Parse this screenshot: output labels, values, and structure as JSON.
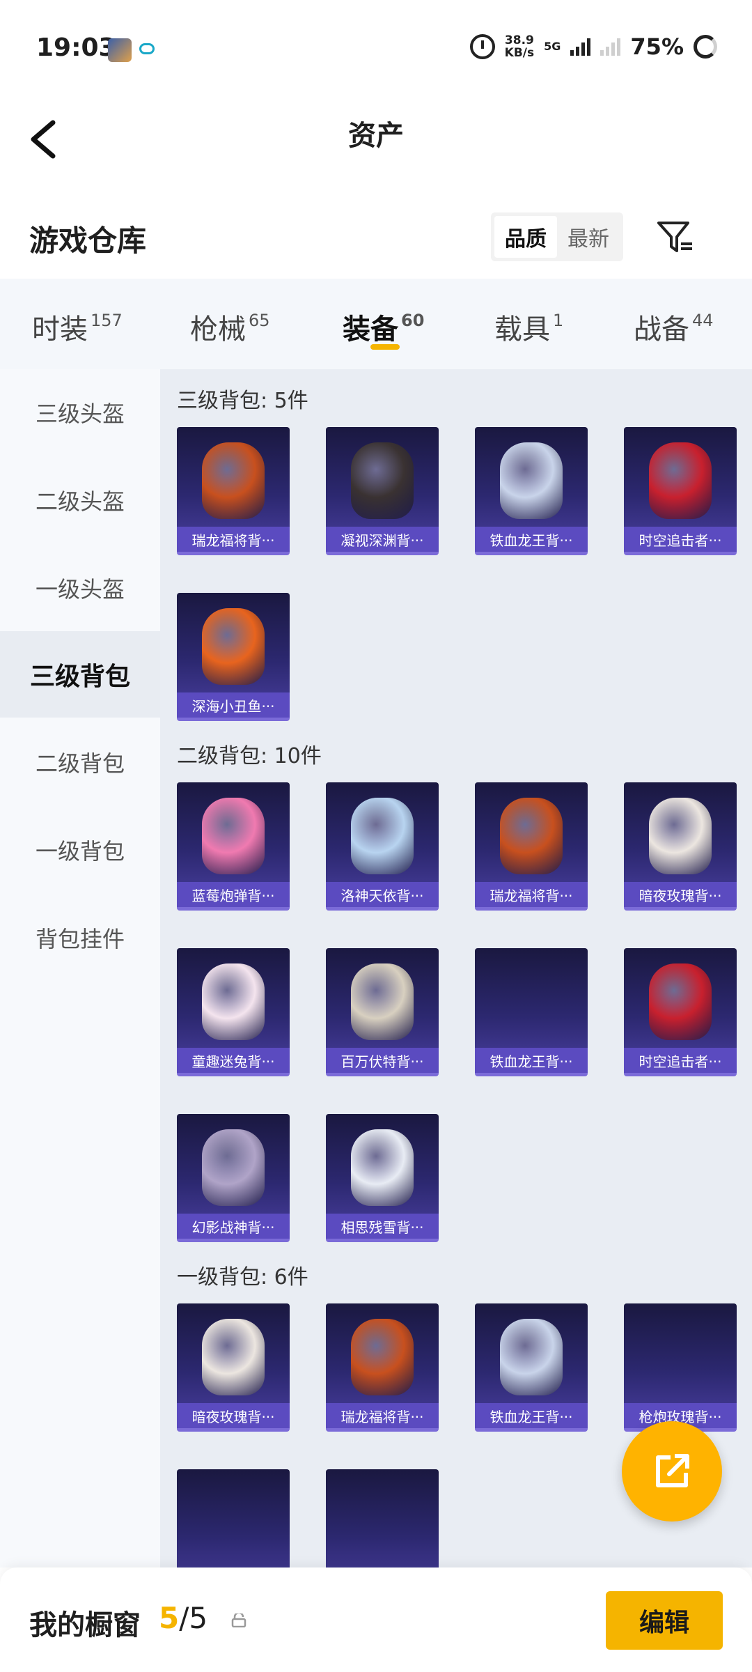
{
  "status_bar": {
    "time": "19:03",
    "net_speed_value": "38.9",
    "net_speed_unit": "KB/s",
    "network_type": "5G",
    "battery": "75%"
  },
  "header": {
    "title": "资产"
  },
  "warehouse": {
    "title": "游戏仓库",
    "sort_options": [
      "品质",
      "最新"
    ],
    "active_sort": "品质"
  },
  "tabs": [
    {
      "label": "时装",
      "count": "157"
    },
    {
      "label": "枪械",
      "count": "65"
    },
    {
      "label": "装备",
      "count": "60",
      "active": true
    },
    {
      "label": "载具",
      "count": "1"
    },
    {
      "label": "战备",
      "count": "44"
    }
  ],
  "sidebar": {
    "items": [
      {
        "label": "三级头盔"
      },
      {
        "label": "二级头盔"
      },
      {
        "label": "一级头盔"
      },
      {
        "label": "三级背包",
        "active": true
      },
      {
        "label": "二级背包"
      },
      {
        "label": "一级背包"
      },
      {
        "label": "背包挂件"
      }
    ]
  },
  "sections": [
    {
      "title": "三级背包: 5件",
      "items": [
        {
          "name": "瑞龙福将背···",
          "color": "#c8501e"
        },
        {
          "name": "凝视深渊背···",
          "color": "#3a3232"
        },
        {
          "name": "铁血龙王背···",
          "color": "#c9d4ea"
        },
        {
          "name": "时空追击者···",
          "color": "#c8202e"
        },
        {
          "name": "深海小丑鱼···",
          "color": "#e8641e"
        }
      ]
    },
    {
      "title": "二级背包: 10件",
      "items": [
        {
          "name": "蓝莓炮弹背···",
          "color": "#f07ab0"
        },
        {
          "name": "洛神天依背···",
          "color": "#b8d4f0"
        },
        {
          "name": "瑞龙福将背···",
          "color": "#c8501e"
        },
        {
          "name": "暗夜玫瑰背···",
          "color": "#ece6e0"
        },
        {
          "name": "童趣迷兔背···",
          "color": "#f4e4ee"
        },
        {
          "name": "百万伏特背···",
          "color": "#d8d0c0"
        },
        {
          "name": "铁血龙王背···",
          "color": ""
        },
        {
          "name": "时空追击者···",
          "color": "#c8202e"
        },
        {
          "name": "幻影战神背···",
          "color": "#b0a4c8"
        },
        {
          "name": "相思残雪背···",
          "color": "#e8ecf4"
        }
      ]
    },
    {
      "title": "一级背包: 6件",
      "items": [
        {
          "name": "暗夜玫瑰背···",
          "color": "#ece6e0"
        },
        {
          "name": "瑞龙福将背···",
          "color": "#c8501e"
        },
        {
          "name": "铁血龙王背···",
          "color": "#c9d4ea"
        },
        {
          "name": "枪炮玫瑰背···",
          "color": ""
        },
        {
          "name": "",
          "color": ""
        },
        {
          "name": "",
          "color": ""
        }
      ]
    }
  ],
  "bottom_bar": {
    "showcase_label": "我的橱窗",
    "showcase_current": "5",
    "showcase_total": "/5",
    "edit_label": "编辑"
  }
}
